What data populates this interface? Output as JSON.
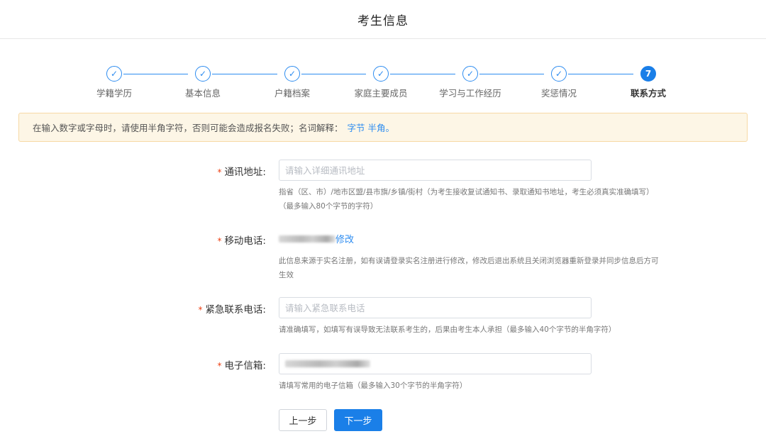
{
  "header": {
    "title": "考生信息"
  },
  "steps": [
    {
      "label": "学籍学历",
      "status": "done",
      "icon": "check-icon"
    },
    {
      "label": "基本信息",
      "status": "done",
      "icon": "check-icon"
    },
    {
      "label": "户籍档案",
      "status": "done",
      "icon": "check-icon"
    },
    {
      "label": "家庭主要成员",
      "status": "done",
      "icon": "check-icon"
    },
    {
      "label": "学习与工作经历",
      "status": "done",
      "icon": "check-icon"
    },
    {
      "label": "奖惩情况",
      "status": "done",
      "icon": "check-icon"
    },
    {
      "label": "联系方式",
      "status": "active",
      "number": "7"
    }
  ],
  "notice": {
    "text": "在输入数字或字母时，请使用半角字符，否则可能会造成报名失败；名词解释：",
    "links": "字节 半角。"
  },
  "form": {
    "address": {
      "label": "通讯地址:",
      "placeholder": "请输入详细通讯地址",
      "hint_line1": "指省（区、市）/地市区盟/县市旗/乡镇/街村（为考生接收复试通知书、录取通知书地址，考生必须真实准确填写）",
      "hint_line2": "（最多输入80个字节的字符）"
    },
    "mobile": {
      "label": "移动电话:",
      "edit_link": "修改",
      "hint_line1": "此信息来源于实名注册，如有误请登录实名注册进行修改，修改后退出系统且关闭浏览器重新登录并同步信息后方可",
      "hint_line2": "生效"
    },
    "emergency": {
      "label": "紧急联系电话:",
      "placeholder": "请输入紧急联系电话",
      "hint": "请准确填写，如填写有误导致无法联系考生的，后果由考生本人承担（最多输入40个字节的半角字符）"
    },
    "email": {
      "label": "电子信箱:",
      "hint": "请填写常用的电子信箱（最多输入30个字节的半角字符）"
    }
  },
  "buttons": {
    "prev": "上一步",
    "next": "下一步"
  },
  "colors": {
    "primary": "#1a7fe8",
    "required": "#ed4014",
    "notice_bg": "#fdf6e6"
  }
}
